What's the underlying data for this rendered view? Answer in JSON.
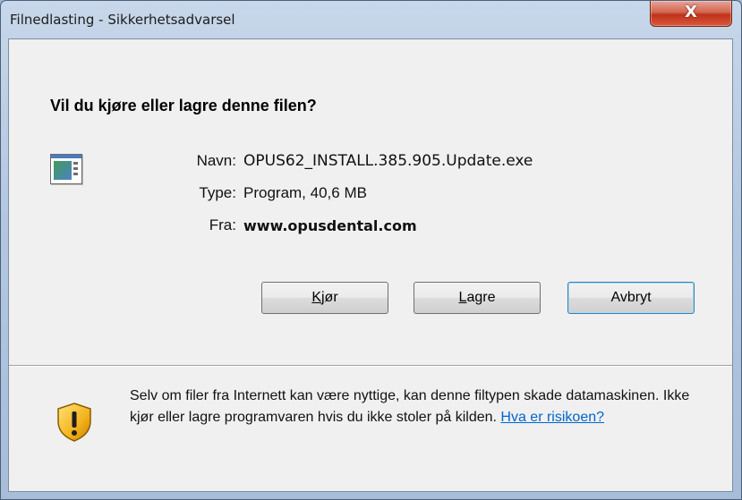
{
  "window": {
    "title": "Filnedlasting - Sikkerhetsadvarsel",
    "close_symbol": "X"
  },
  "dialog": {
    "question": "Vil du kjøre eller lagre denne filen?",
    "file_icon": "program-window-icon",
    "details": [
      {
        "label": "Navn:",
        "value": "OPUS62_INSTALL.385.905.Update.exe"
      },
      {
        "label": "Type:",
        "value": "Program, 40,6 MB"
      },
      {
        "label": "Fra:",
        "value": "www.opusdental.com"
      }
    ],
    "buttons": {
      "run": {
        "mnemonic": "K",
        "rest": "jør"
      },
      "save": {
        "mnemonic": "L",
        "rest": "agre"
      },
      "cancel": {
        "label": "Avbryt"
      }
    },
    "warning": {
      "icon": "shield-warning-icon",
      "text": "Selv om filer fra Internett kan være nyttige, kan denne filtypen skade datamaskinen. Ikke kjør eller lagre programvaren hvis du ikke stoler på kilden.",
      "link": "Hva er risikoen?"
    }
  },
  "colors": {
    "link": "#0066cc",
    "close_button": "#c0331b",
    "default_button_border": "#3c7fb1"
  }
}
